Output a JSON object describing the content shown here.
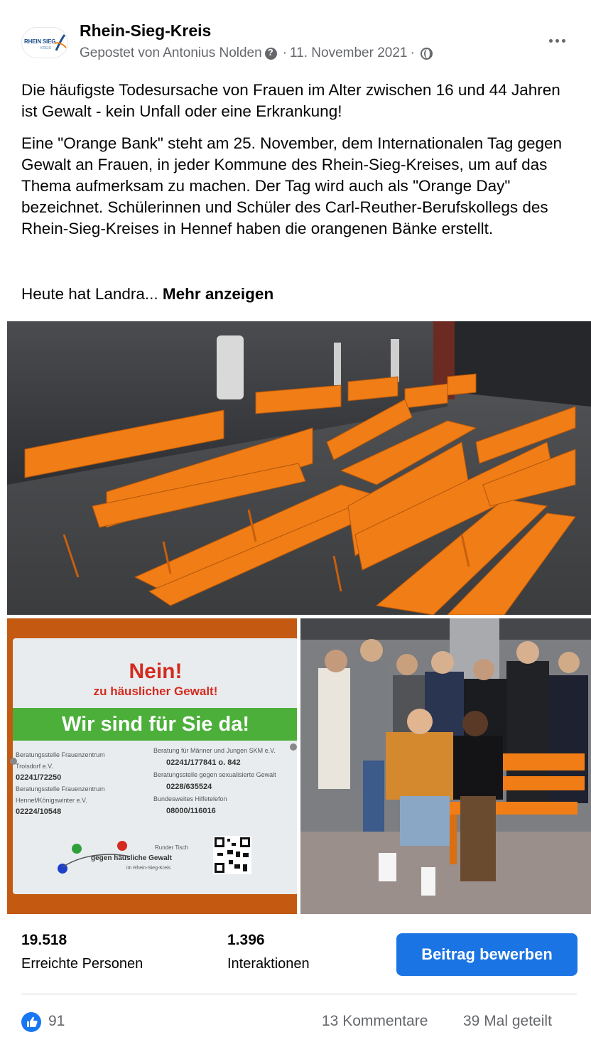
{
  "post": {
    "page_name": "Rhein-Sieg-Kreis",
    "posted_by": "Gepostet von Antonius Nolden",
    "date": "11. November 2021",
    "separator": "·",
    "avatar_text": "RHEIN SIEG",
    "avatar_subtext": "KREIS",
    "paragraph1": "Die häufigste Todesursache von Frauen im Alter zwischen 16 und 44 Jahren ist Gewalt - kein Unfall oder eine Erkrankung!",
    "paragraph2": "Eine \"Orange Bank\" steht am 25. November, dem Internationalen Tag gegen Gewalt an Frauen, in jeder Kommune des Rhein-Sieg-Kreises, um auf das Thema aufmerksam zu machen. Der Tag wird auch als \"Orange Day\" bezeichnet. Schülerinnen und Schüler des Carl-Reuther-Berufskollegs des Rhein-Sieg-Kreises in Hennef haben die orangenen Bänke erstellt.",
    "paragraph3": "Heute hat Landra...",
    "more_link": "Mehr anzeigen"
  },
  "sign": {
    "title": "Nein!",
    "subtitle": "zu häuslicher Gewalt!",
    "banner": "Wir sind für Sie da!",
    "left_col": [
      "Beratungsstelle Frauenzentrum",
      "Troisdorf e.V.",
      "02241/72250",
      "Beratungsstelle Frauenzentrum",
      "Hennef/Königswinter e.V.",
      "02224/10548"
    ],
    "right_col": [
      "Beratung für Männer und Jungen SKM e.V.",
      "02241/177841 o. 842",
      "Beratungsstelle gegen sexualisierte Gewalt",
      "0228/635524",
      "Bundesweites Hilfetelefon",
      "08000/116016"
    ],
    "footer_top": "Runder Tisch",
    "footer_main": "gegen häusliche Gewalt",
    "footer_sub": "im Rhein-Sieg-Kreis"
  },
  "stats": {
    "reach_value": "19.518",
    "reach_label": "Erreichte Personen",
    "interactions_value": "1.396",
    "interactions_label": "Interaktionen",
    "promote_label": "Beitrag bewerben"
  },
  "reactions": {
    "likes": "91",
    "comments": "13 Kommentare",
    "shares": "39 Mal geteilt"
  },
  "colors": {
    "brand_blue": "#1b74e4",
    "bench_orange": "#f07d16",
    "secondary_text": "#65676b"
  }
}
